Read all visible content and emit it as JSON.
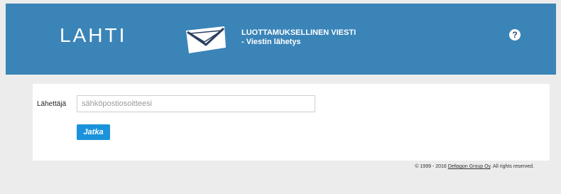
{
  "header": {
    "logo_text": "LAHTI",
    "title_line1": "LUOTTAMUKSELLINEN VIESTI",
    "title_line2": "- Viestin lähetys",
    "help_icon": "question-mark-icon",
    "help_glyph": "?",
    "background_color": "#3a84b8"
  },
  "form": {
    "sender_label": "Lähettäjä",
    "email_placeholder": "sähköpostiosoitteesi",
    "email_value": "",
    "continue_label": "Jatka",
    "button_color": "#1b93dc"
  },
  "footer": {
    "copyright_prefix": "© 1999 - 2016",
    "company_link": "Deltagon Group Oy",
    "rights": ". All rights reserved."
  }
}
